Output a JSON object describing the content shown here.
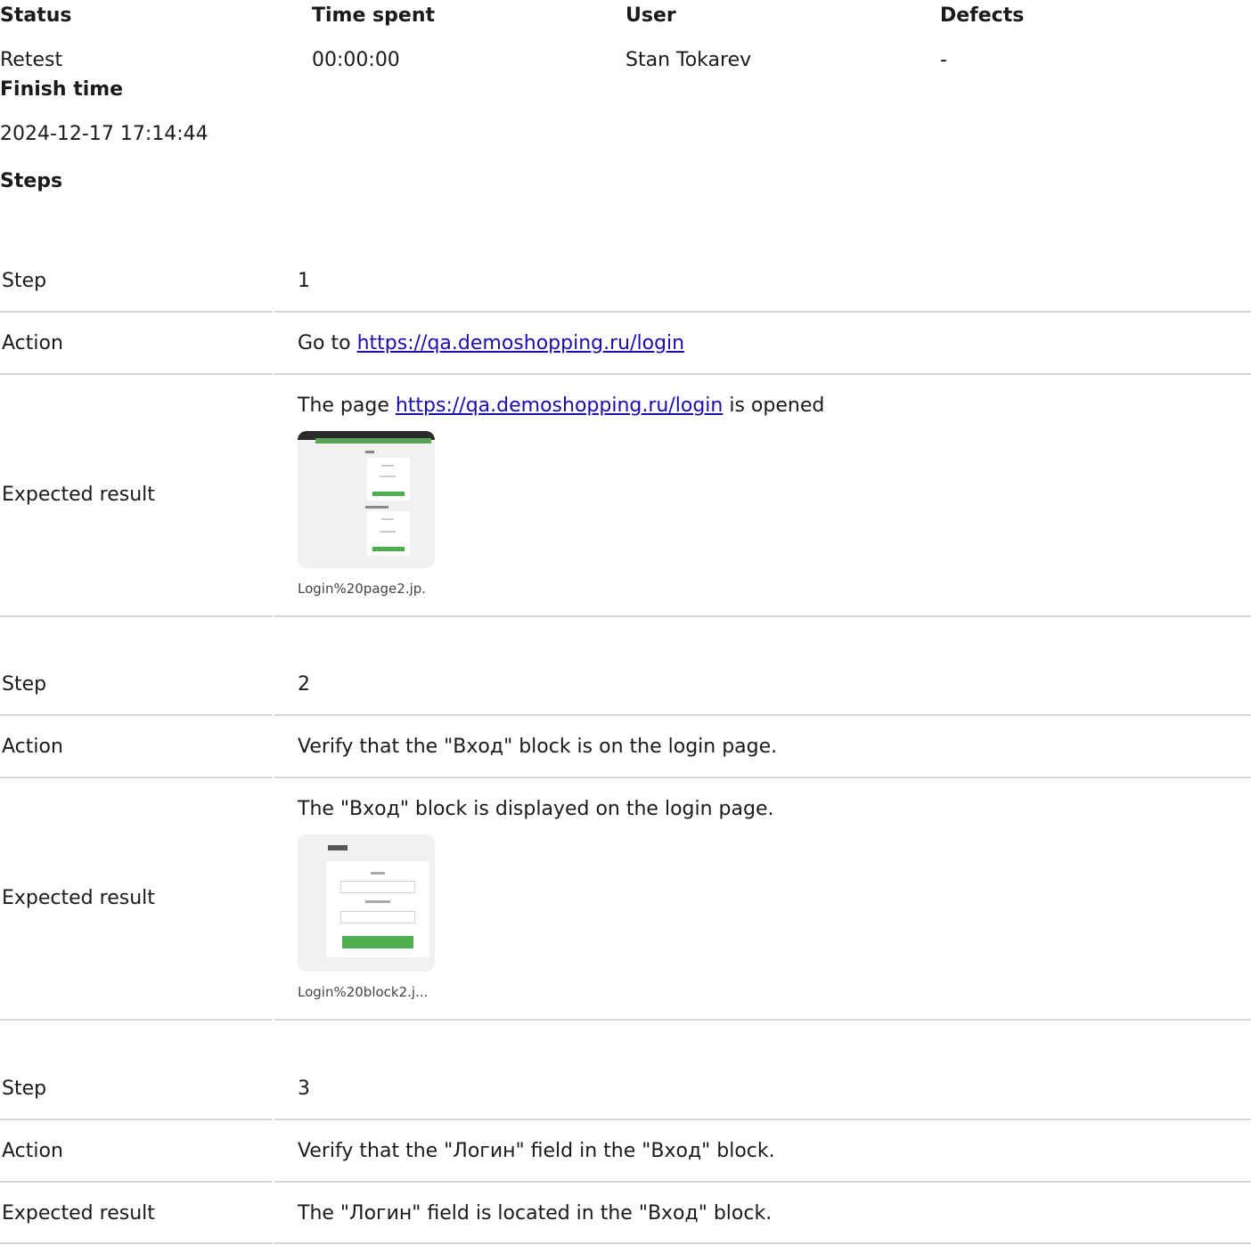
{
  "header": {
    "status_label": "Status",
    "time_label": "Time spent",
    "user_label": "User",
    "defects_label": "Defects",
    "status_value": "Retest",
    "time_value": "00:00:00",
    "user_value": "Stan Tokarev",
    "defects_value": "-",
    "finish_label": "Finish time",
    "finish_value": "2024-12-17 17:14:44",
    "steps_label": "Steps"
  },
  "labels": {
    "step": "Step",
    "action": "Action",
    "expected": "Expected result"
  },
  "steps": [
    {
      "number": "1",
      "action_prefix": "Go to ",
      "action_link": "https://qa.demoshopping.ru/login",
      "expected_prefix": "The page ",
      "expected_link": "https://qa.demoshopping.ru/login",
      "expected_suffix": " is opened",
      "attachment_name": "Login%20page2.jp."
    },
    {
      "number": "2",
      "action": "Verify that the \"Вход\" block is on the login page.",
      "expected": "The \"Вход\" block is displayed on the login page.",
      "attachment_name": "Login%20block2.j..."
    },
    {
      "number": "3",
      "action": "Verify that the \"Логин\" field in the \"Вход\" block.",
      "expected": "The \"Логин\" field is located in the \"Вход\" block."
    }
  ]
}
